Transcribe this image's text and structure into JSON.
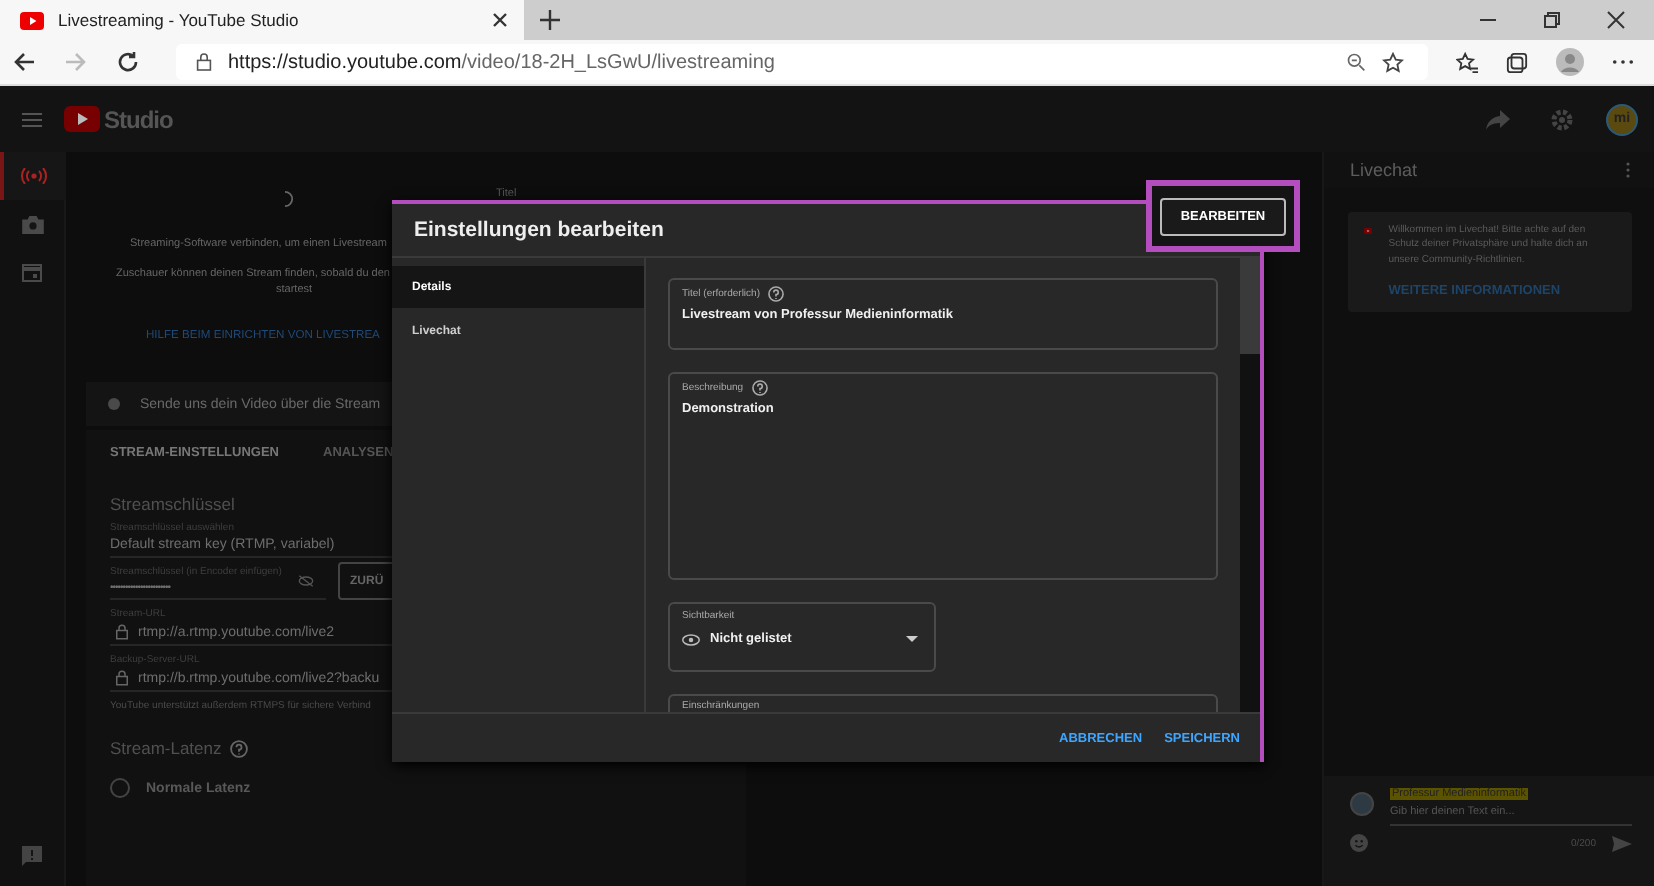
{
  "browser": {
    "tab_title": "Livestreaming - YouTube Studio",
    "url_host": "https://studio.youtube.com",
    "url_path": "/video/18-2H_LsGwU/livestreaming"
  },
  "header": {
    "logo_text": "Studio",
    "avatar_text": "mi"
  },
  "rail": [
    {
      "kind": "live",
      "selected": true
    },
    {
      "kind": "camera",
      "selected": false
    },
    {
      "kind": "calendar",
      "selected": false
    }
  ],
  "setup": {
    "title_label": "Titel",
    "lines": [
      "Streaming-Software verbinden, um einen Livestream",
      "Zuschauer können deinen Stream finden, sobald du den",
      "startest"
    ],
    "help_link": "HILFE BEIM EINRICHTEN VON LIVESTREA",
    "status": "Sende uns dein Video über die Stream"
  },
  "tabs": [
    {
      "label": "STREAM-EINSTELLUNGEN",
      "selected": true
    },
    {
      "label": "ANALYSEN",
      "selected": false
    }
  ],
  "stream_key": {
    "heading": "Streamschlüssel",
    "select_label": "Streamschlüssel auswählen",
    "select_value": "Default stream key (RTMP, variabel)",
    "key_label": "Streamschlüssel (in Encoder einfügen)",
    "key_value": "••••••••••••••••••••••••",
    "reset_button": "ZURÜ",
    "url_label": "Stream-URL",
    "url_value": "rtmp://a.rtmp.youtube.com/live2",
    "backup_label": "Backup-Server-URL",
    "backup_value": "rtmp://b.rtmp.youtube.com/live2?backu",
    "note": "YouTube unterstützt außerdem RTMPS für sichere Verbind"
  },
  "latency": {
    "heading": "Stream-Latenz",
    "options": [
      {
        "label": "Normale Latenz",
        "checked": false
      }
    ]
  },
  "modal": {
    "title": "Einstellungen bearbeiten",
    "nav": [
      {
        "label": "Details",
        "selected": true
      },
      {
        "label": "Livechat",
        "selected": false
      }
    ],
    "fields": [
      {
        "kind": "text",
        "label": "Titel (erforderlich)",
        "help": true,
        "value": "Livestream von Professur Medieninformatik"
      },
      {
        "kind": "textarea",
        "label": "Beschreibung",
        "help": true,
        "value": "Demonstration"
      },
      {
        "kind": "select",
        "label": "Sichtbarkeit",
        "help": false,
        "value": "Nicht gelistet"
      },
      {
        "kind": "cut",
        "label": "Einschränkungen",
        "help": false
      }
    ],
    "buttons": [
      "ABBRECHEN",
      "SPEICHERN"
    ]
  },
  "highlighted_button": "BEARBEITEN",
  "chat": {
    "title": "Livechat",
    "notice": "Willkommen im Livechat! Bitte achte auf den Schutz deiner Privatsphäre und halte dich an unsere Community-Richtlinien.",
    "notice_link": "WEITERE INFORMATIONEN",
    "author": "Professur Medieninformatik",
    "placeholder": "Gib hier deinen Text ein...",
    "counter": "0/200"
  }
}
